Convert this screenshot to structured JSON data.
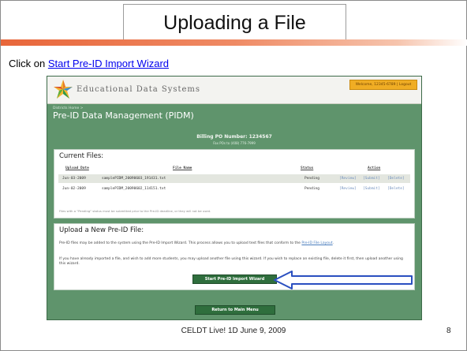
{
  "slide": {
    "title": "Uploading a File",
    "instruction_prefix": "Click on ",
    "instruction_link": "Start Pre-ID Import Wizard",
    "footer": "CELDT Live! 1D June 9, 2009",
    "page_number": "8",
    "accent_color": "#e8663a"
  },
  "app": {
    "logo_text": "Educational Data Systems",
    "login_info": "Welcome, 12345-6789 | Logout",
    "breadcrumb": "Districts Home >",
    "page_title": "Pre-ID Data Management (PIDM)",
    "po_label": "Billing PO Number: 1234567",
    "po_sub": "Fax POs to (408) 776-7999",
    "brand_color": "#5f946c"
  },
  "current_files": {
    "title": "Current Files:",
    "columns": [
      "Upload Date",
      "File Name",
      "Status",
      "Action"
    ],
    "rows": [
      {
        "date": "Jun-03-2009",
        "file": "samplePIDM_20090603_191431.txt",
        "status": "Pending",
        "actions": [
          "[Review]",
          "[Submit]",
          "[Delete]"
        ]
      },
      {
        "date": "Jun-02-2009",
        "file": "samplePIDM_20090602_114151.txt",
        "status": "Pending",
        "actions": [
          "[Review]",
          "[Submit]",
          "[Delete]"
        ]
      }
    ],
    "note": "Files with a \"Pending\" status must be submitted prior to the Pre-ID deadline, or they will not be used."
  },
  "upload": {
    "title": "Upload a New Pre-ID File:",
    "para1": "Pre-ID files may be added to the system using the Pre-ID Import Wizard. This process allows you to upload text files that conform to the ",
    "para1_link": "Pre-ID File Layout",
    "para1_end": ".",
    "para2": "If you have already imported a file, and wish to add more students, you may upload another file using this wizard. If you wish to replace an existing file, delete it first, then upload another using this wizard.",
    "wizard_button": "Start Pre-ID Import Wizard"
  },
  "return_button": "Return to Main Menu"
}
